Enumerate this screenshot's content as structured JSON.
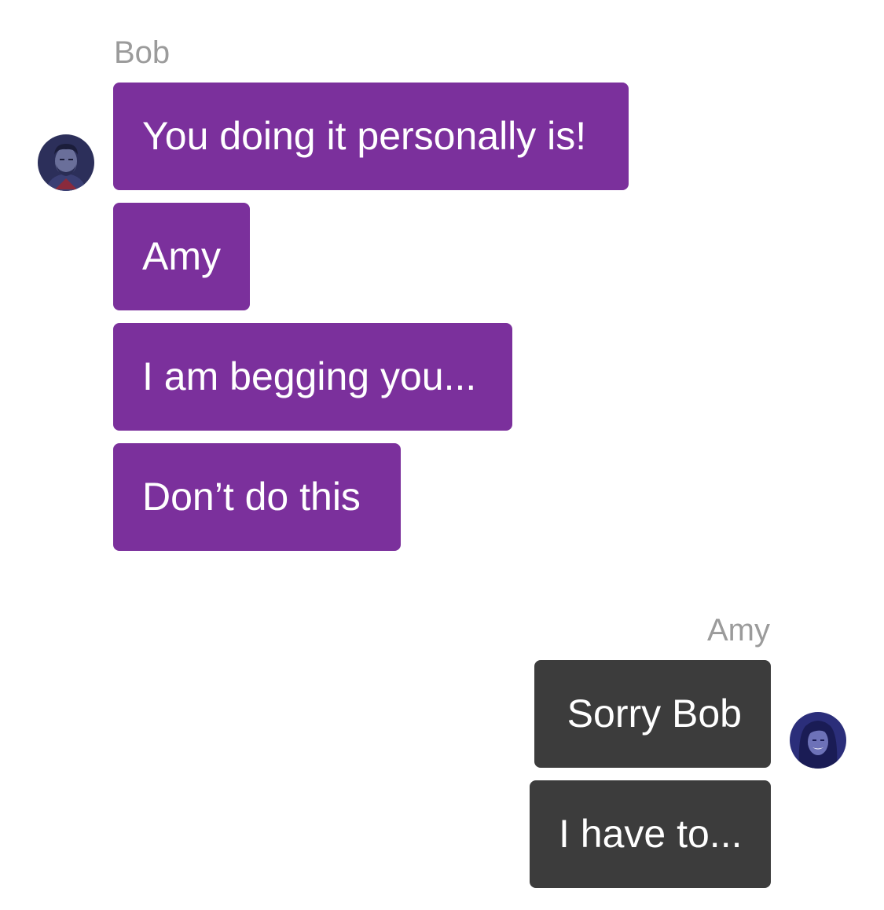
{
  "conversation": {
    "incoming": {
      "sender": "Bob",
      "avatar_icon": "male-avatar-icon",
      "bubble_color": "#7b309c",
      "messages": [
        "You doing it personally is!",
        "Amy",
        "I am begging you...",
        "Don’t do this"
      ]
    },
    "outgoing": {
      "sender": "Amy",
      "avatar_icon": "female-avatar-icon",
      "bubble_color": "#3c3c3c",
      "messages": [
        "Sorry Bob",
        "I have to..."
      ]
    }
  },
  "colors": {
    "sender_name": "#9b9b9b",
    "bubble_text": "#ffffff",
    "background": "#ffffff"
  }
}
